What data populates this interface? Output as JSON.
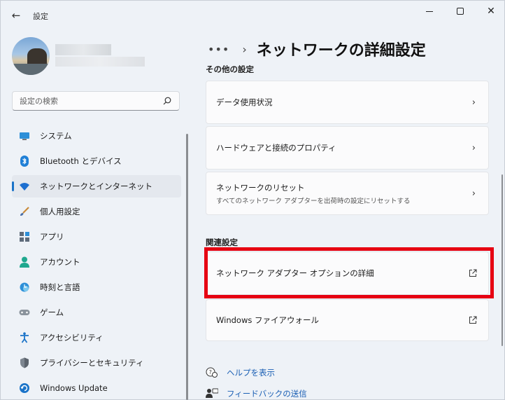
{
  "window": {
    "app_title": "設定",
    "back_icon": "back-arrow-icon",
    "controls": [
      "minimize-icon",
      "maximize-icon",
      "close-icon"
    ]
  },
  "search": {
    "placeholder": "設定の検索"
  },
  "sidebar": {
    "items": [
      {
        "label": "システム",
        "icon": "system-display-icon",
        "active": false
      },
      {
        "label": "Bluetooth とデバイス",
        "icon": "bluetooth-icon",
        "active": false
      },
      {
        "label": "ネットワークとインターネット",
        "icon": "wifi-icon",
        "active": true
      },
      {
        "label": "個人用設定",
        "icon": "paintbrush-icon",
        "active": false
      },
      {
        "label": "アプリ",
        "icon": "apps-icon",
        "active": false
      },
      {
        "label": "アカウント",
        "icon": "account-icon",
        "active": false
      },
      {
        "label": "時刻と言語",
        "icon": "time-language-icon",
        "active": false
      },
      {
        "label": "ゲーム",
        "icon": "game-controller-icon",
        "active": false
      },
      {
        "label": "アクセシビリティ",
        "icon": "accessibility-icon",
        "active": false
      },
      {
        "label": "プライバシーとセキュリティ",
        "icon": "shield-icon",
        "active": false
      },
      {
        "label": "Windows Update",
        "icon": "windows-update-icon",
        "active": false
      }
    ]
  },
  "main": {
    "breadcrumb_dots": "•••",
    "breadcrumb_sep": "›",
    "page_title": "ネットワークの詳細設定",
    "section_cut": "その他の設定",
    "cards": [
      {
        "label": "データ使用状況"
      },
      {
        "label": "ハードウェアと接続のプロパティ"
      },
      {
        "label": "ネットワークのリセット",
        "sub": "すべてのネットワーク アダプターを出荷時の設定にリセットする"
      }
    ],
    "related_heading": "関連設定",
    "related": [
      {
        "label": "ネットワーク アダプター オプションの詳細"
      },
      {
        "label": "Windows ファイアウォール"
      }
    ],
    "help": [
      {
        "label": "ヘルプを表示",
        "icon": "help-icon"
      },
      {
        "label": "フィードバックの送信",
        "icon": "feedback-icon"
      }
    ]
  },
  "colors": {
    "accent": "#1a73c8",
    "highlight_box": "#e60012",
    "link": "#1a5fb4"
  }
}
